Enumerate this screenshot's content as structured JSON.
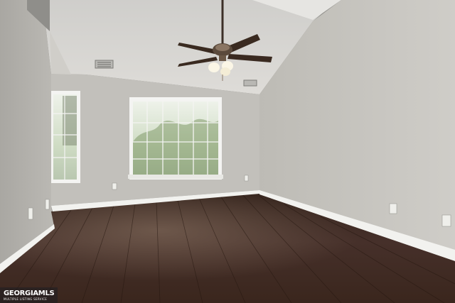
{
  "photo": {
    "subject": "Empty room with vaulted ceiling, ceiling fan, two windows and dark hardwood floor"
  },
  "watermark": {
    "brand": "GEORGIAMLS",
    "tagline": "MULTIPLE LISTING SERVICE"
  },
  "colors": {
    "wall_left": "#b9b7b2",
    "wall_back": "#c2c0bb",
    "wall_right": "#c7c5c0",
    "ceiling": "#d6d5d1",
    "floor": "#3a261d",
    "floor_highlight": "#6a5548",
    "trim": "#f2f2ef",
    "window_glass": "#dfe6dc",
    "foliage": "#6f8c55"
  }
}
